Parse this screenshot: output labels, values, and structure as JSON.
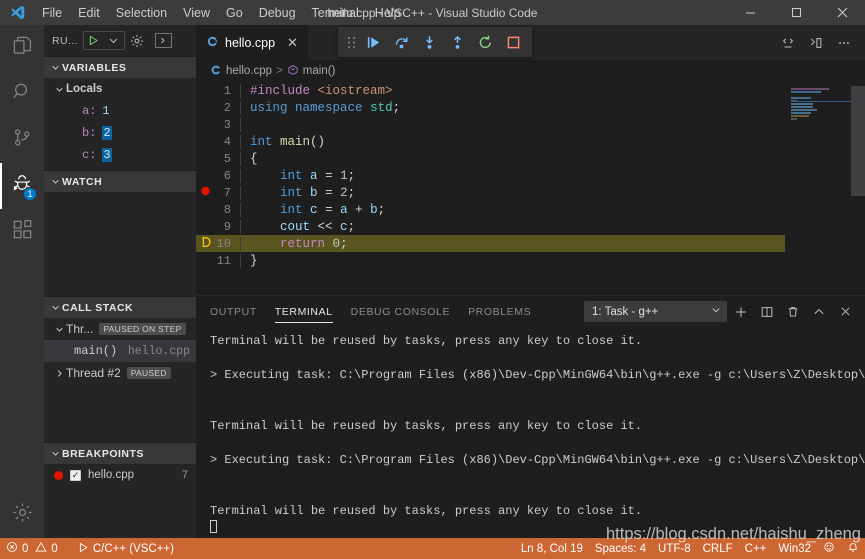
{
  "window": {
    "title": "hello.cpp - VSC++ - Visual Studio Code",
    "minimize_label": "—",
    "maximize_label": "☐",
    "close_label": "✕"
  },
  "menubar": {
    "items": [
      {
        "label": "File"
      },
      {
        "label": "Edit"
      },
      {
        "label": "Selection"
      },
      {
        "label": "View"
      },
      {
        "label": "Go"
      },
      {
        "label": "Debug"
      },
      {
        "label": "Terminal"
      },
      {
        "label": "Help"
      }
    ]
  },
  "activitybar": {
    "items": [
      {
        "name": "explorer-icon",
        "label": "Explorer"
      },
      {
        "name": "search-icon",
        "label": "Search"
      },
      {
        "name": "source-control-icon",
        "label": "Source Control"
      },
      {
        "name": "run-debug-icon",
        "label": "Run and Debug",
        "badge": "1",
        "active": true
      },
      {
        "name": "extensions-icon",
        "label": "Extensions"
      }
    ],
    "bottom": {
      "name": "settings-gear-icon",
      "label": "Manage"
    }
  },
  "sidebar": {
    "header": {
      "title": "RU...",
      "start_label": "Start Debugging",
      "config_label": "Open launch.json",
      "terminal_label": "Debug Console"
    },
    "variables": {
      "title": "VARIABLES",
      "scope": "Locals",
      "items": [
        {
          "name": "a:",
          "value": "1",
          "highlighted": false
        },
        {
          "name": "b:",
          "value": "2",
          "highlighted": true
        },
        {
          "name": "c:",
          "value": "3",
          "highlighted": true
        }
      ]
    },
    "watch": {
      "title": "WATCH"
    },
    "callstack": {
      "title": "CALL STACK",
      "items": [
        {
          "label": "Thr...",
          "badge": "PAUSED ON STEP",
          "file": "",
          "expanded": true,
          "selected": false
        },
        {
          "label": "main()",
          "badge": "",
          "file": "hello.cpp",
          "expanded": null,
          "selected": true
        },
        {
          "label": "Thread #2",
          "badge": "PAUSED",
          "file": "",
          "expanded": false,
          "selected": false
        }
      ]
    },
    "breakpoints": {
      "title": "BREAKPOINTS",
      "items": [
        {
          "file": "hello.cpp",
          "line": "7",
          "checked": true
        }
      ]
    }
  },
  "editor": {
    "tab": {
      "label": "hello.cpp",
      "icon": "cpp-file-icon",
      "close_label": "✕"
    },
    "tab_actions": [
      {
        "name": "run-code-icon",
        "label": "Run Code"
      },
      {
        "name": "split-editor-icon",
        "label": "Split Editor"
      },
      {
        "name": "more-actions-icon",
        "label": "More Actions..."
      }
    ],
    "breadcrumb": {
      "file": "hello.cpp",
      "separator": ">",
      "symbol": "main()"
    },
    "lines": [
      {
        "n": "1",
        "tokens": [
          {
            "t": "#include",
            "c": "t-pre"
          },
          {
            "t": " ",
            "c": "t-plain"
          },
          {
            "t": "<iostream>",
            "c": "t-str"
          }
        ],
        "current": false,
        "breakpoint": false
      },
      {
        "n": "2",
        "tokens": [
          {
            "t": "using",
            "c": "t-kw"
          },
          {
            "t": " ",
            "c": "t-plain"
          },
          {
            "t": "namespace",
            "c": "t-kw"
          },
          {
            "t": " ",
            "c": "t-plain"
          },
          {
            "t": "std",
            "c": "t-ns"
          },
          {
            "t": ";",
            "c": "t-plain"
          }
        ],
        "current": false,
        "breakpoint": false
      },
      {
        "n": "3",
        "tokens": [],
        "current": false,
        "breakpoint": false
      },
      {
        "n": "4",
        "tokens": [
          {
            "t": "int",
            "c": "t-kw"
          },
          {
            "t": " ",
            "c": "t-plain"
          },
          {
            "t": "main",
            "c": "t-fn"
          },
          {
            "t": "()",
            "c": "t-plain"
          }
        ],
        "current": false,
        "breakpoint": false
      },
      {
        "n": "5",
        "tokens": [
          {
            "t": "{",
            "c": "t-plain"
          }
        ],
        "current": false,
        "breakpoint": false
      },
      {
        "n": "6",
        "tokens": [
          {
            "t": "    ",
            "c": "t-plain"
          },
          {
            "t": "int",
            "c": "t-kw"
          },
          {
            "t": " ",
            "c": "t-plain"
          },
          {
            "t": "a",
            "c": "t-var"
          },
          {
            "t": " = ",
            "c": "t-plain"
          },
          {
            "t": "1",
            "c": "t-num"
          },
          {
            "t": ";",
            "c": "t-plain"
          }
        ],
        "current": false,
        "breakpoint": false
      },
      {
        "n": "7",
        "tokens": [
          {
            "t": "    ",
            "c": "t-plain"
          },
          {
            "t": "int",
            "c": "t-kw"
          },
          {
            "t": " ",
            "c": "t-plain"
          },
          {
            "t": "b",
            "c": "t-var"
          },
          {
            "t": " = ",
            "c": "t-plain"
          },
          {
            "t": "2",
            "c": "t-num"
          },
          {
            "t": ";",
            "c": "t-plain"
          }
        ],
        "current": false,
        "breakpoint": true
      },
      {
        "n": "8",
        "tokens": [
          {
            "t": "    ",
            "c": "t-plain"
          },
          {
            "t": "int",
            "c": "t-kw"
          },
          {
            "t": " ",
            "c": "t-plain"
          },
          {
            "t": "c",
            "c": "t-var"
          },
          {
            "t": " = ",
            "c": "t-plain"
          },
          {
            "t": "a",
            "c": "t-var"
          },
          {
            "t": " + ",
            "c": "t-plain"
          },
          {
            "t": "b",
            "c": "t-var"
          },
          {
            "t": ";",
            "c": "t-plain"
          }
        ],
        "current": false,
        "breakpoint": false
      },
      {
        "n": "9",
        "tokens": [
          {
            "t": "    ",
            "c": "t-plain"
          },
          {
            "t": "cout",
            "c": "t-var"
          },
          {
            "t": " << ",
            "c": "t-plain"
          },
          {
            "t": "c",
            "c": "t-var"
          },
          {
            "t": ";",
            "c": "t-plain"
          }
        ],
        "current": false,
        "breakpoint": false
      },
      {
        "n": "10",
        "tokens": [
          {
            "t": "    ",
            "c": "t-plain"
          },
          {
            "t": "return",
            "c": "t-pre"
          },
          {
            "t": " ",
            "c": "t-plain"
          },
          {
            "t": "0",
            "c": "t-num"
          },
          {
            "t": ";",
            "c": "t-plain"
          }
        ],
        "current": true,
        "breakpoint": false,
        "execution_pointer": true
      },
      {
        "n": "11",
        "tokens": [
          {
            "t": "}",
            "c": "t-plain"
          }
        ],
        "current": false,
        "breakpoint": false
      }
    ]
  },
  "debug_toolbar": {
    "buttons": [
      {
        "name": "drag-handle-icon",
        "label": "Drag"
      },
      {
        "name": "continue-icon",
        "label": "Continue"
      },
      {
        "name": "step-over-icon",
        "label": "Step Over"
      },
      {
        "name": "step-into-icon",
        "label": "Step Into"
      },
      {
        "name": "step-out-icon",
        "label": "Step Out"
      },
      {
        "name": "restart-icon",
        "label": "Restart"
      },
      {
        "name": "stop-icon",
        "label": "Stop"
      }
    ]
  },
  "panel": {
    "tabs": [
      {
        "label": "OUTPUT",
        "active": false
      },
      {
        "label": "TERMINAL",
        "active": true
      },
      {
        "label": "DEBUG CONSOLE",
        "active": false
      },
      {
        "label": "PROBLEMS",
        "active": false
      }
    ],
    "terminal_select": "1: Task - g++",
    "actions": [
      {
        "name": "new-terminal-icon",
        "label": "+"
      },
      {
        "name": "split-terminal-icon",
        "label": "Split"
      },
      {
        "name": "kill-terminal-icon",
        "label": "Kill"
      },
      {
        "name": "maximize-panel-icon",
        "label": "Maximize Panel"
      },
      {
        "name": "close-panel-icon",
        "label": "Close Panel"
      }
    ],
    "terminal_lines": [
      "Terminal will be reused by tasks, press any key to close it.",
      "",
      "> Executing task: C:\\Program Files (x86)\\Dev-Cpp\\MinGW64\\bin\\g++.exe -g c:\\Users\\Z\\Desktop\\V",
      "",
      "",
      "Terminal will be reused by tasks, press any key to close it.",
      "",
      "> Executing task: C:\\Program Files (x86)\\Dev-Cpp\\MinGW64\\bin\\g++.exe -g c:\\Users\\Z\\Desktop\\V",
      "",
      "",
      "Terminal will be reused by tasks, press any key to close it."
    ]
  },
  "statusbar": {
    "errors": "0",
    "warnings": "0",
    "task": "C/C++ (VSC++)",
    "cursor": "Ln 8, Col 19",
    "indentation": "Spaces: 4",
    "encoding": "UTF-8",
    "eol": "CRLF",
    "language": "C++",
    "platform": "Win32",
    "feedback_icon": "smiley-icon",
    "notifications_icon": "bell-icon"
  },
  "watermark": "https://blog.csdn.net/haishu_zheng",
  "colors": {
    "status_bar": "#cc6633",
    "accent": "#007acc",
    "breakpoint": "#e51400",
    "current_line": "#5a5420"
  }
}
